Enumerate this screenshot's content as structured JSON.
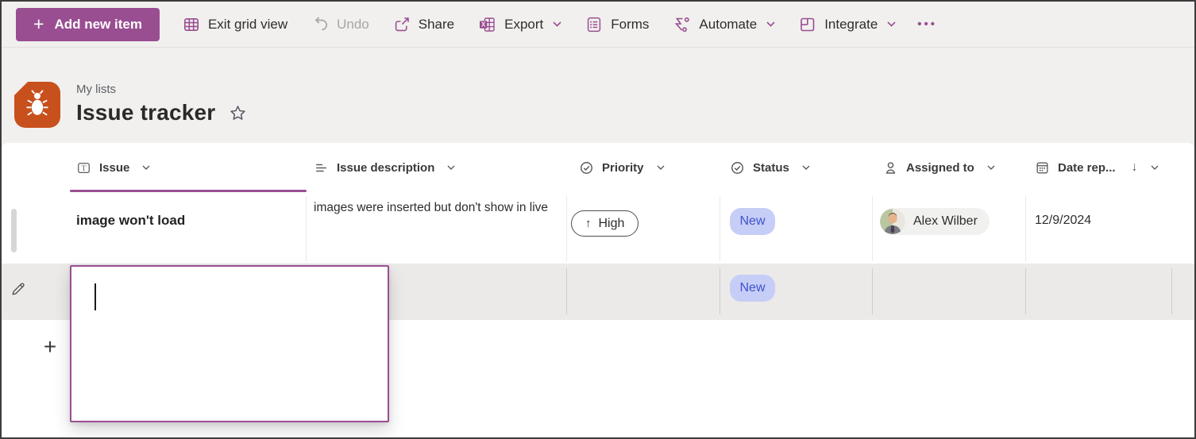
{
  "toolbar": {
    "add_button": {
      "icon": "+",
      "label": "Add new item"
    },
    "items": [
      {
        "label": "Exit grid view"
      },
      {
        "label": "Undo"
      },
      {
        "label": "Share"
      },
      {
        "label": "Export"
      },
      {
        "label": "Forms"
      },
      {
        "label": "Automate"
      },
      {
        "label": "Integrate"
      }
    ],
    "more_label": "•••"
  },
  "header": {
    "breadcrumb": "My lists",
    "title": "Issue tracker"
  },
  "grid": {
    "columns": [
      {
        "label": "Issue"
      },
      {
        "label": "Issue description"
      },
      {
        "label": "Priority"
      },
      {
        "label": "Status"
      },
      {
        "label": "Assigned to"
      },
      {
        "label": "Date rep...",
        "sort_icon": "↓"
      }
    ],
    "rows": [
      {
        "issue": "image won't load",
        "description": "images were inserted but don't show in live",
        "priority": "High",
        "priority_icon": "↑",
        "status": "New",
        "assigned_to": "Alex Wilber",
        "date_reported": "12/9/2024"
      }
    ],
    "new_row": {
      "status": "New"
    },
    "add_row_icon": "+"
  },
  "colors": {
    "accent_purple": "#9a4e92",
    "list_icon_orange": "#c8501c",
    "status_new_bg": "#c6cdf7",
    "status_new_text": "#3e53c9",
    "toolbar_bg": "#f1f0ee"
  }
}
